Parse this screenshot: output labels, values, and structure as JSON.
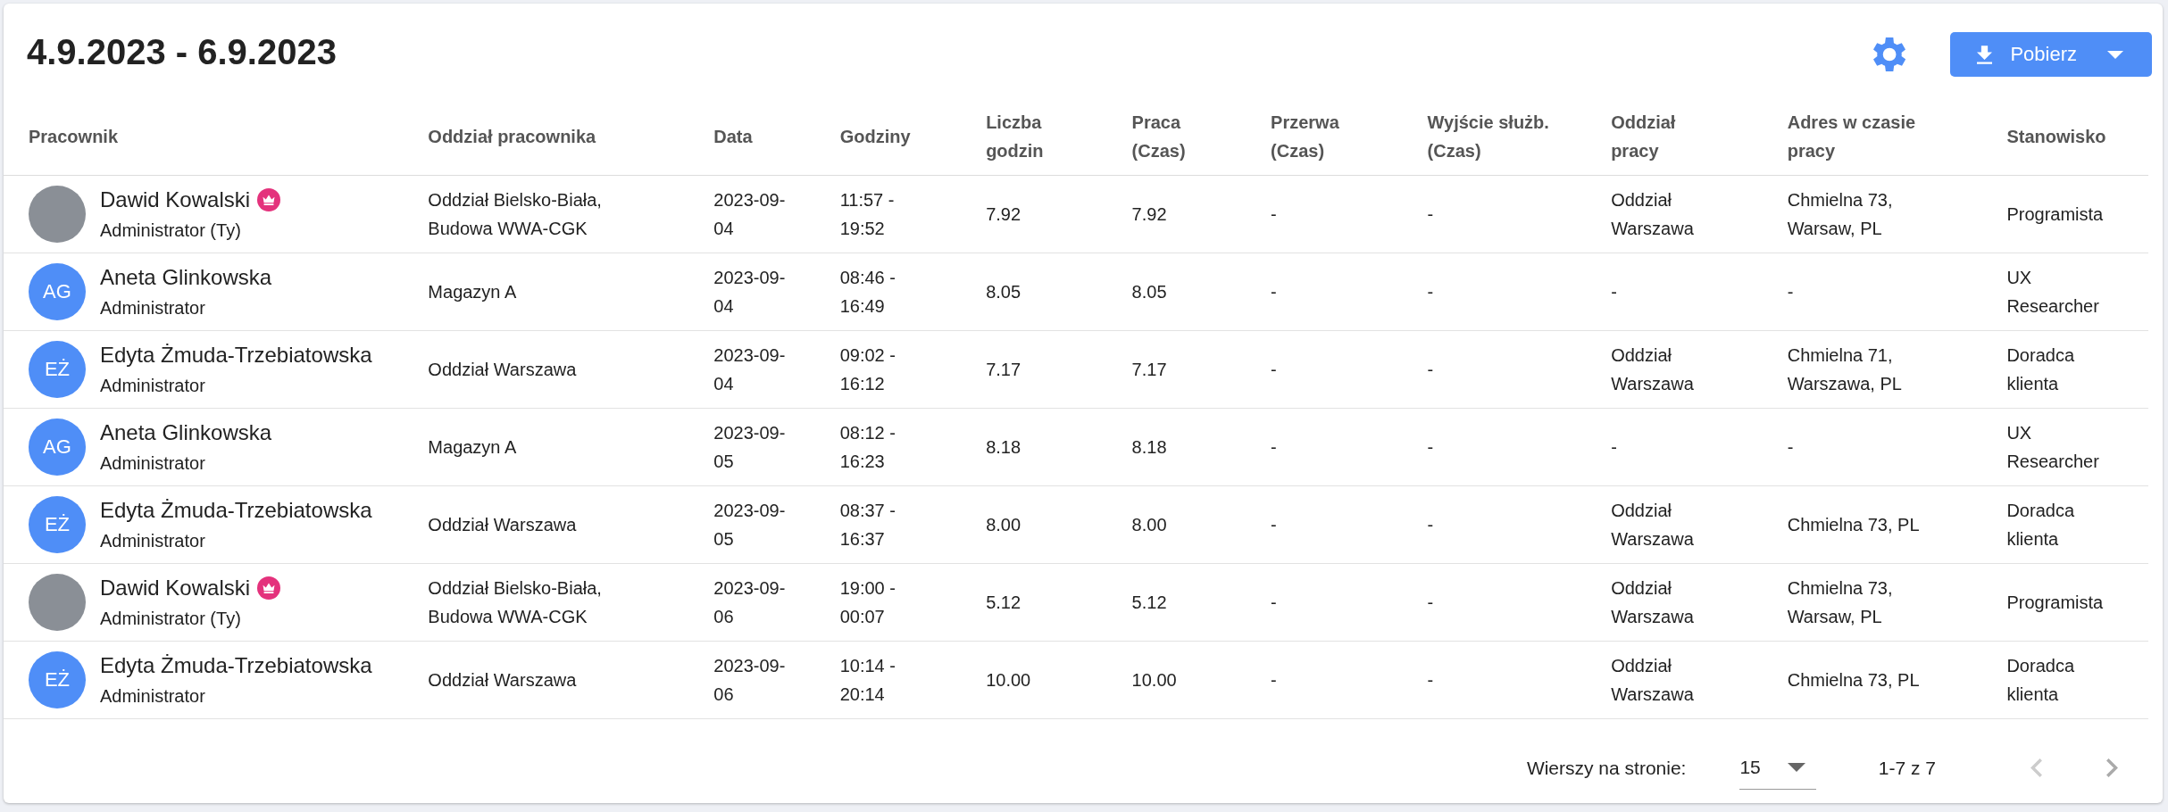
{
  "title": "4.9.2023 - 6.9.2023",
  "download_button": {
    "label": "Pobierz"
  },
  "table": {
    "columns": [
      "Pracownik",
      "Oddział pracownika",
      "Data",
      "Godziny",
      "Liczba godzin",
      "Praca (Czas)",
      "Przerwa (Czas)",
      "Wyjście służb. (Czas)",
      "Oddział pracy",
      "Adres w czasie pracy",
      "Stanowisko"
    ],
    "rows": [
      {
        "cells": [
          {
            "name": "Dawid Kowalski",
            "crown": true,
            "role": "Administrator (Ty)",
            "avatar": {
              "kind": "photo"
            }
          },
          "Oddział Bielsko-Biała, Budowa WWA-CGK",
          "2023-09-04",
          "11:57 - 19:52",
          "7.92",
          "7.92",
          "-",
          "-",
          "Oddział Warszawa",
          "Chmielna 73, Warsaw, PL",
          "Programista"
        ]
      },
      {
        "cells": [
          {
            "name": "Aneta Glinkowska",
            "crown": false,
            "role": "Administrator",
            "avatar": {
              "kind": "initials",
              "text": "AG"
            }
          },
          "Magazyn A",
          "2023-09-04",
          "08:46 - 16:49",
          "8.05",
          "8.05",
          "-",
          "-",
          "-",
          "-",
          "UX Researcher"
        ]
      },
      {
        "cells": [
          {
            "name": "Edyta Żmuda-Trzebiatowska",
            "crown": false,
            "role": "Administrator",
            "avatar": {
              "kind": "initials",
              "text": "EŻ"
            }
          },
          "Oddział Warszawa",
          "2023-09-04",
          "09:02 - 16:12",
          "7.17",
          "7.17",
          "-",
          "-",
          "Oddział Warszawa",
          "Chmielna 71, Warszawa, PL",
          "Doradca klienta"
        ]
      },
      {
        "cells": [
          {
            "name": "Aneta Glinkowska",
            "crown": false,
            "role": "Administrator",
            "avatar": {
              "kind": "initials",
              "text": "AG"
            }
          },
          "Magazyn A",
          "2023-09-05",
          "08:12 - 16:23",
          "8.18",
          "8.18",
          "-",
          "-",
          "-",
          "-",
          "UX Researcher"
        ]
      },
      {
        "cells": [
          {
            "name": "Edyta Żmuda-Trzebiatowska",
            "crown": false,
            "role": "Administrator",
            "avatar": {
              "kind": "initials",
              "text": "EŻ"
            }
          },
          "Oddział Warszawa",
          "2023-09-05",
          "08:37 - 16:37",
          "8.00",
          "8.00",
          "-",
          "-",
          "Oddział Warszawa",
          "Chmielna 73, PL",
          "Doradca klienta"
        ]
      },
      {
        "cells": [
          {
            "name": "Dawid Kowalski",
            "crown": true,
            "role": "Administrator (Ty)",
            "avatar": {
              "kind": "photo"
            }
          },
          "Oddział Bielsko-Biała, Budowa WWA-CGK",
          "2023-09-06",
          "19:00 - 00:07",
          "5.12",
          "5.12",
          "-",
          "-",
          "Oddział Warszawa",
          "Chmielna 73, Warsaw, PL",
          "Programista"
        ]
      },
      {
        "cells": [
          {
            "name": "Edyta Żmuda-Trzebiatowska",
            "crown": false,
            "role": "Administrator",
            "avatar": {
              "kind": "initials",
              "text": "EŻ"
            }
          },
          "Oddział Warszawa",
          "2023-09-06",
          "10:14 - 20:14",
          "10.00",
          "10.00",
          "-",
          "-",
          "Oddział Warszawa",
          "Chmielna 73, PL",
          "Doradca klienta"
        ]
      }
    ]
  },
  "pagination": {
    "rows_label": "Wierszy na stronie:",
    "rows_per_page": "15",
    "range": "1-7 z 7",
    "prev_disabled": true,
    "next_disabled": false
  }
}
